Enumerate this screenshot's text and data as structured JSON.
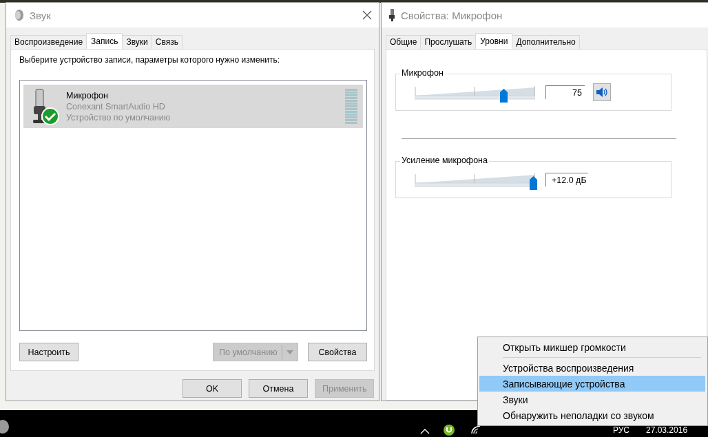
{
  "sound_window": {
    "title": "Звук",
    "tabs": [
      {
        "label": "Воспроизведение",
        "selected": false
      },
      {
        "label": "Запись",
        "selected": true
      },
      {
        "label": "Звуки",
        "selected": false
      },
      {
        "label": "Связь",
        "selected": false
      }
    ],
    "instruction": "Выберите устройство записи, параметры которого нужно изменить:",
    "devices": [
      {
        "name": "Микрофон",
        "driver": "Conexant SmartAudio HD",
        "status": "Устройство по умолчанию",
        "selected": true,
        "default": true
      }
    ],
    "buttons": [
      {
        "label": "Настроить",
        "kind": "button",
        "disabled": false
      },
      {
        "label": "По умолчанию",
        "kind": "split",
        "disabled": true
      },
      {
        "label": "Свойства",
        "kind": "button",
        "disabled": false
      }
    ],
    "dialog_buttons": [
      {
        "label": "OK",
        "disabled": false
      },
      {
        "label": "Отмена",
        "disabled": false
      },
      {
        "label": "Применить",
        "disabled": true
      }
    ]
  },
  "properties_window": {
    "title": "Свойства: Микрофон",
    "tabs": [
      {
        "label": "Общие",
        "selected": false
      },
      {
        "label": "Прослушать",
        "selected": false
      },
      {
        "label": "Уровни",
        "selected": true
      },
      {
        "label": "Дополнительно",
        "selected": false
      }
    ],
    "groups": [
      {
        "label": "Микрофон",
        "kind": "volume",
        "level": 0.75,
        "reading": "75"
      },
      {
        "label": "Усиление микрофона",
        "kind": "boost",
        "level": 1,
        "reading": "+12.0 дБ"
      }
    ]
  },
  "context_menu": {
    "items": [
      {
        "label": "Открыть микшер громкости",
        "selected": false,
        "separator_after": true
      },
      {
        "label": "Устройства воспроизведения",
        "selected": false,
        "separator_after": false
      },
      {
        "label": "Записывающие устройства",
        "selected": true,
        "separator_after": false
      },
      {
        "label": "Звуки",
        "selected": false,
        "separator_after": false
      },
      {
        "label": "Обнаружить неполадки со звуком",
        "selected": false,
        "separator_after": false
      }
    ]
  },
  "taskbar": {
    "language": "РУС",
    "date": "27.03.2016"
  }
}
